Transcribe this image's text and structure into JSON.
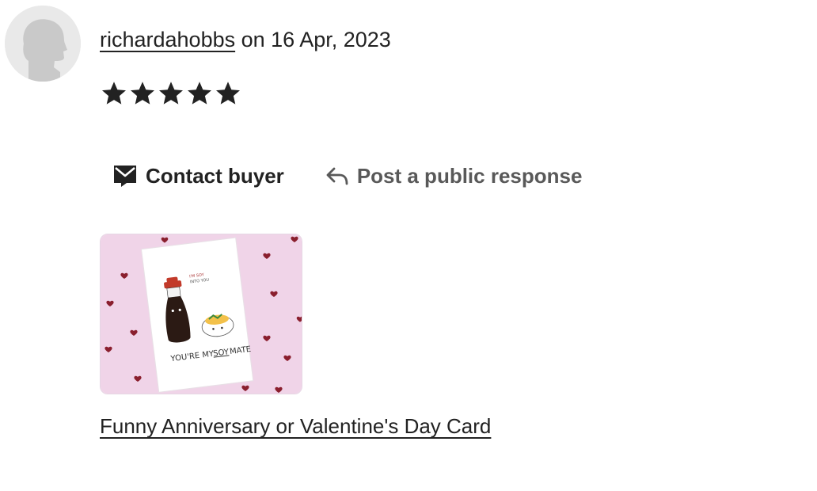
{
  "review": {
    "username": "richardahobbs",
    "date_text": " on 16 Apr, 2023",
    "rating": 5,
    "rating_max": 5
  },
  "actions": {
    "contact_label": "Contact buyer",
    "public_response_label": "Post a public response"
  },
  "listing": {
    "title": "Funny Anniversary or Valentine's Day Card",
    "card_caption": "YOU'RE MY",
    "card_caption_emph": "SOY",
    "card_caption_end": "MATE",
    "card_speech": "I'M SOY",
    "card_speech_2": "INTO YOU"
  },
  "colors": {
    "text": "#222222",
    "muted": "#595959",
    "thumb_bg": "#f0d4e8",
    "heart": "#8a1f2e"
  },
  "icons": {
    "avatar": "person-silhouette-icon",
    "star": "star-filled-icon",
    "contact": "envelope-icon",
    "reply": "reply-arrow-icon"
  }
}
